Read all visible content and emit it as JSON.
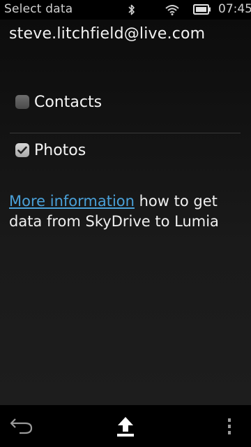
{
  "status_bar": {
    "title": "Select data",
    "time": "07:45",
    "icons": [
      "bluetooth-icon",
      "wifi-icon",
      "battery-icon"
    ]
  },
  "account": {
    "email": "steve.litchfield@live.com"
  },
  "options": [
    {
      "label": "Contacts",
      "checked": false
    },
    {
      "label": "Photos",
      "checked": true
    }
  ],
  "info": {
    "link_text": "More information",
    "text": " how to get data from SkyDrive to Lumia"
  },
  "toolbar": {
    "icons": [
      "back-icon",
      "upload-icon",
      "menu-icon"
    ]
  },
  "colors": {
    "link": "#4aa0d8",
    "background": "#111111",
    "bars": "#000000"
  }
}
